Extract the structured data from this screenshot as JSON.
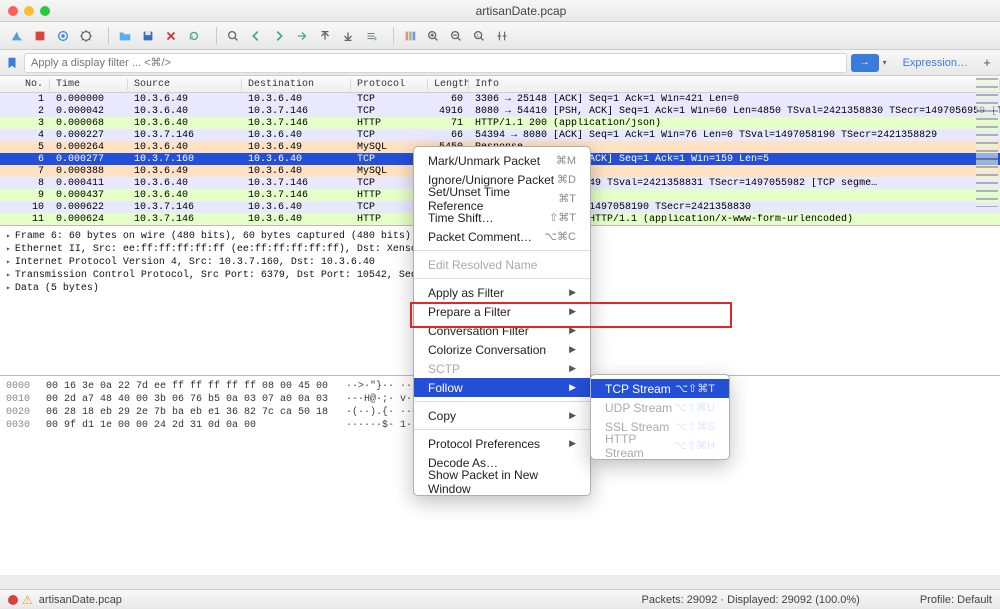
{
  "window": {
    "title": "artisanDate.pcap"
  },
  "filter": {
    "placeholder": "Apply a display filter ... <⌘/>",
    "expression_label": "Expression…"
  },
  "columns": {
    "no": "No.",
    "time": "Time",
    "src": "Source",
    "dst": "Destination",
    "proto": "Protocol",
    "len": "Length",
    "info": "Info"
  },
  "packets": [
    {
      "no": 1,
      "time": "0.000000",
      "src": "10.3.6.49",
      "dst": "10.3.6.40",
      "proto": "TCP",
      "len": 60,
      "info": "3306 → 25148  [ACK] Seq=1 Ack=1 Win=421 Len=0",
      "cls": "tcp"
    },
    {
      "no": 2,
      "time": "0.000042",
      "src": "10.3.6.40",
      "dst": "10.3.7.146",
      "proto": "TCP",
      "len": 4916,
      "info": "8080 → 54410  [PSH, ACK] Seq=1 Ack=1 Win=60 Len=4850 TSval=2421358830 TSecr=1497056959 [TCP segme…",
      "cls": "tcp"
    },
    {
      "no": 3,
      "time": "0.000068",
      "src": "10.3.6.40",
      "dst": "10.3.7.146",
      "proto": "HTTP",
      "len": 71,
      "info": "HTTP/1.1 200    (application/json)",
      "cls": "http"
    },
    {
      "no": 4,
      "time": "0.000227",
      "src": "10.3.7.146",
      "dst": "10.3.6.40",
      "proto": "TCP",
      "len": 66,
      "info": "54394 → 8080  [ACK] Seq=1 Ack=1 Win=76 Len=0 TSval=1497058190 TSecr=2421358829",
      "cls": "tcp"
    },
    {
      "no": 5,
      "time": "0.000264",
      "src": "10.3.6.40",
      "dst": "10.3.6.49",
      "proto": "MySQL",
      "len": 5450,
      "info": "Response",
      "cls": "mysql"
    },
    {
      "no": 6,
      "time": "0.000277",
      "src": "10.3.7.160",
      "dst": "10.3.6.40",
      "proto": "TCP",
      "len": 60,
      "info": "6379 → 10542  [PSH, ACK] Seq=1 Ack=1 Win=159 Len=5",
      "cls": "selected"
    },
    {
      "no": 7,
      "time": "0.000388",
      "src": "10.3.6.49",
      "dst": "10.3.6.40",
      "proto": "MySQL",
      "len": "",
      "info": "",
      "cls": "mysql"
    },
    {
      "no": 8,
      "time": "0.000411",
      "src": "10.3.6.40",
      "dst": "10.3.7.146",
      "proto": "TCP",
      "len": "",
      "info": "                   Ack=1 Win=60 Len=4849 TSval=2421358831 TSecr=1497055982 [TCP segme…",
      "cls": "tcp"
    },
    {
      "no": 9,
      "time": "0.000437",
      "src": "10.3.6.40",
      "dst": "10.3.7.146",
      "proto": "HTTP",
      "len": "",
      "info": "                   json)",
      "cls": "http"
    },
    {
      "no": 10,
      "time": "0.000622",
      "src": "10.3.7.146",
      "dst": "10.3.6.40",
      "proto": "TCP",
      "len": "",
      "info": "                   Win=58 Len=0 TSval=1497058190 TSecr=2421358830",
      "cls": "tcp"
    },
    {
      "no": 11,
      "time": "0.000624",
      "src": "10.3.7.146",
      "dst": "10.3.6.40",
      "proto": "HTTP",
      "len": "",
      "info": "                   /stock/artisanDate HTTP/1.1   (application/x-www-form-urlencoded)",
      "cls": "http"
    }
  ],
  "details": {
    "l0": "Frame 6: 60 bytes on wire (480 bits), 60 bytes captured (480 bits)",
    "l1": "Ethernet II, Src: ee:ff:ff:ff:ff:ff (ee:ff:ff:ff:ff:ff), Dst: Xensourc_0a…",
    "l2": "Internet Protocol Version 4, Src: 10.3.7.160, Dst: 10.3.6.40",
    "l3": "Transmission Control Protocol, Src Port: 6379, Dst Port: 10542, Seq: 1, A…",
    "l4": "Data (5 bytes)"
  },
  "hex": [
    {
      "off": "0000",
      "b": "00 16 3e 0a 22 7d ee ff  ff ff ff ff 08 00 45 00",
      "a": "··>·\"}·· ······E·"
    },
    {
      "off": "0010",
      "b": "00 2d a7 48 40 00 3b 06  76 b5 0a 03 07 a0 0a 03",
      "a": "·-·H@·;· v·······"
    },
    {
      "off": "0020",
      "b": "06 28 18 eb 29 2e 7b ba  eb e1 36 82 7c ca 50 18",
      "a": "·(··).{· ··6·|·P·"
    },
    {
      "off": "0030",
      "b": "00 9f d1 1e 00 00 24 2d  31 0d 0a 00",
      "a": "······$- 1···"
    }
  ],
  "context": {
    "mark": "Mark/Unmark Packet",
    "mark_s": "⌘M",
    "ignore": "Ignore/Unignore Packet",
    "ignore_s": "⌘D",
    "timeref": "Set/Unset Time Reference",
    "timeref_s": "⌘T",
    "timeshift": "Time Shift…",
    "timeshift_s": "⇧⌘T",
    "comment": "Packet Comment…",
    "comment_s": "⌥⌘C",
    "editname": "Edit Resolved Name",
    "applyf": "Apply as Filter",
    "prepf": "Prepare a Filter",
    "convf": "Conversation Filter",
    "colorc": "Colorize Conversation",
    "sctp": "SCTP",
    "follow": "Follow",
    "copy": "Copy",
    "protopref": "Protocol Preferences",
    "decode": "Decode As…",
    "showwin": "Show Packet in New Window"
  },
  "submenu": {
    "tcp": "TCP Stream",
    "tcp_s": "⌥⇧⌘T",
    "udp": "UDP Stream",
    "udp_s": "⌥⇧⌘U",
    "ssl": "SSL Stream",
    "ssl_s": "⌥⇧⌘S",
    "http": "HTTP Stream",
    "http_s": "⌥⇧⌘H"
  },
  "status": {
    "file": "artisanDate.pcap",
    "packets": "Packets: 29092 · Displayed: 29092 (100.0%)",
    "profile": "Profile: Default"
  }
}
